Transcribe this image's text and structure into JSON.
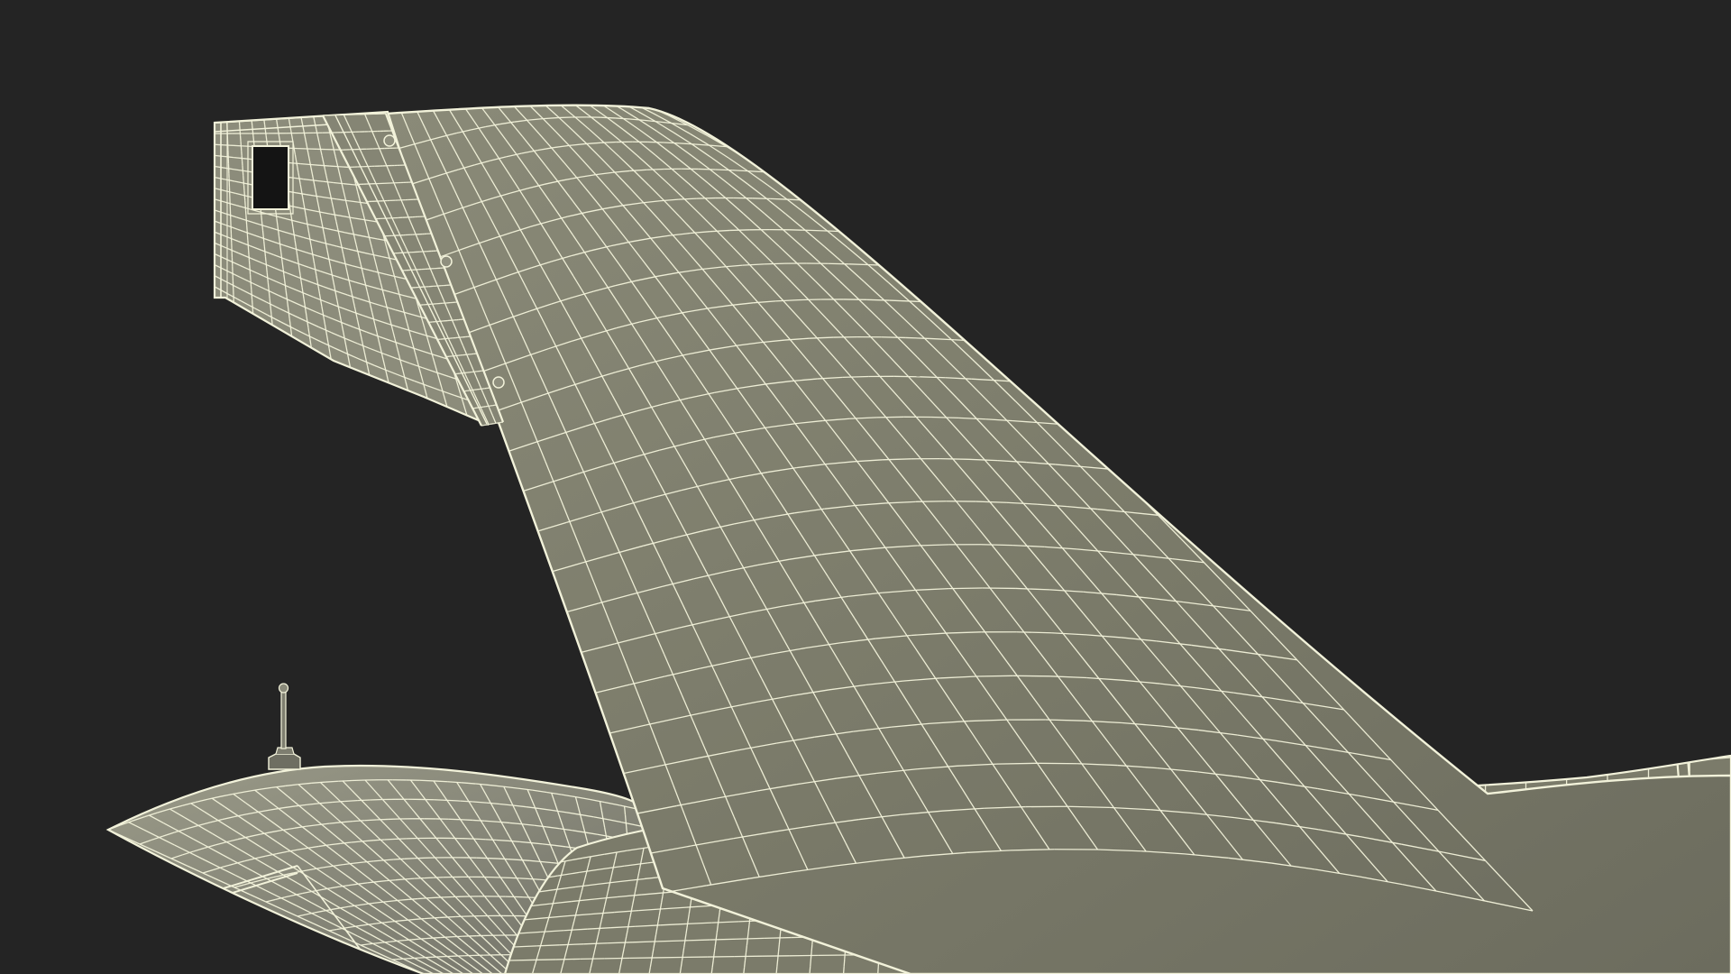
{
  "scene": {
    "background": "#242424",
    "surface_color": "#7d7d6c",
    "surface_color_light": "#8f8f7e",
    "surface_color_dark": "#66665a",
    "wire_color": "#f2f2da",
    "cutout_color": "#141414"
  }
}
